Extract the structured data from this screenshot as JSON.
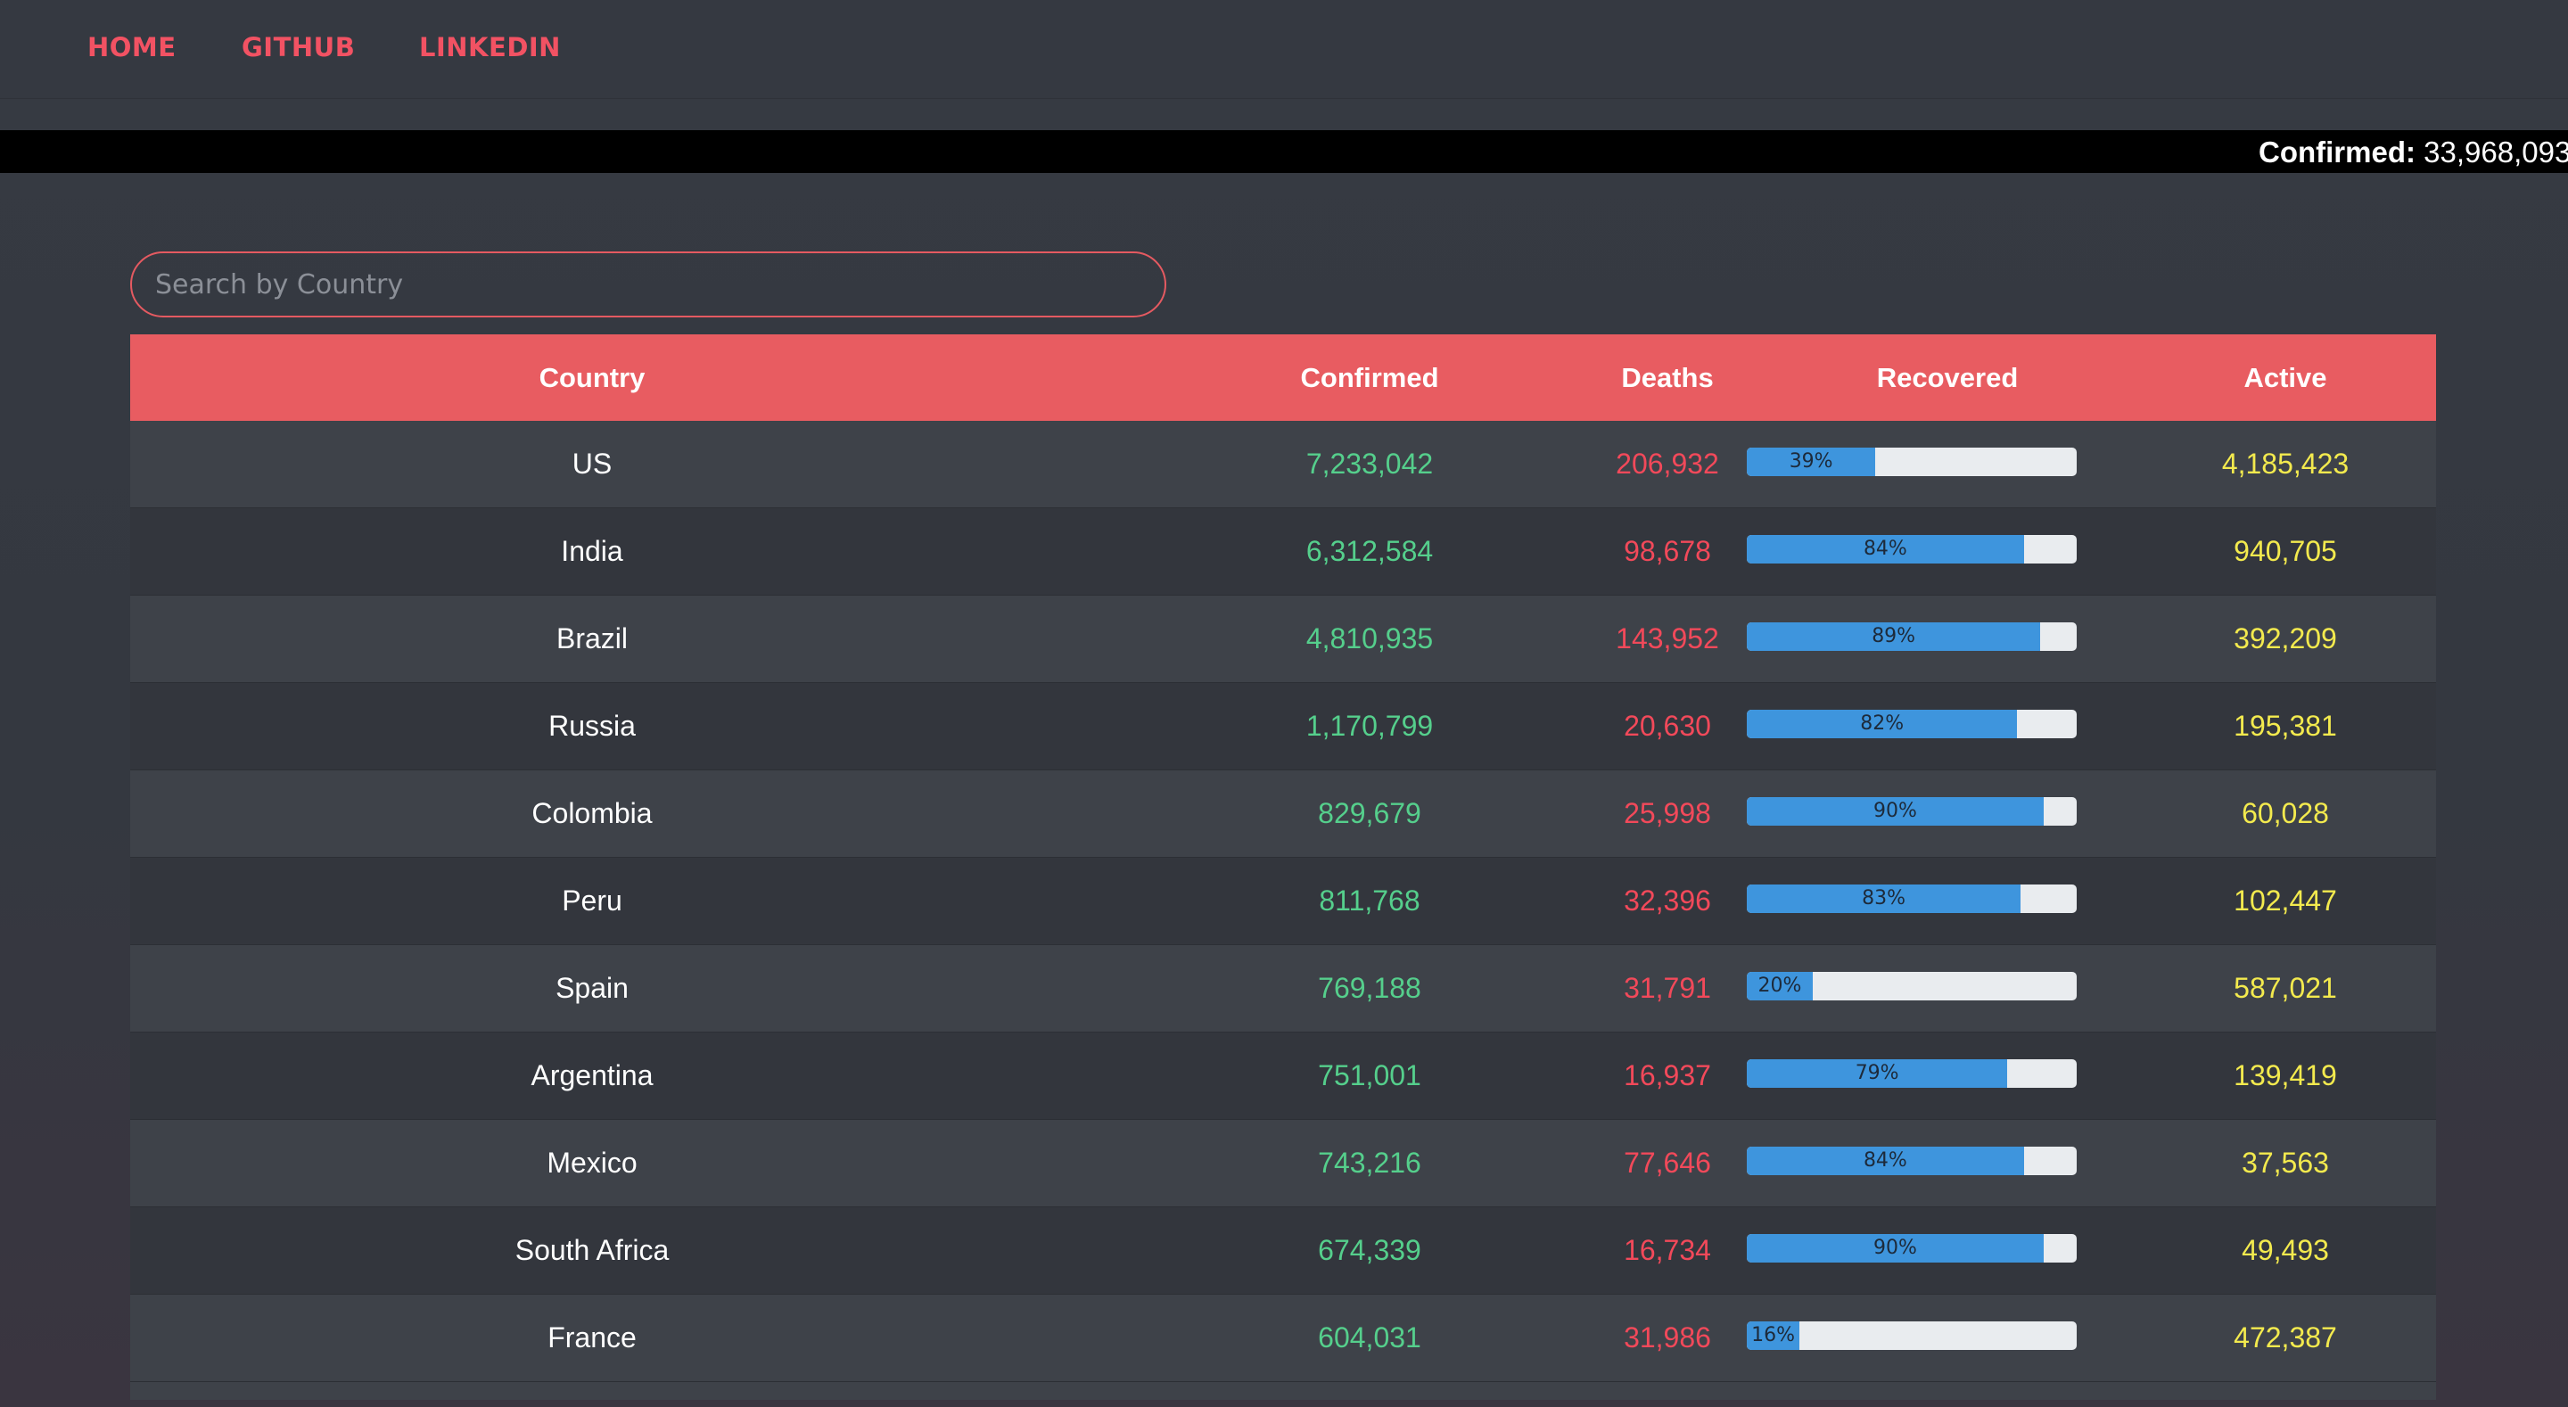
{
  "nav": {
    "home": "HOME",
    "github": "GITHUB",
    "linkedin": "LINKEDIN"
  },
  "ticker": {
    "label": "Confirmed:",
    "value": "33,968,093"
  },
  "search": {
    "placeholder": "Search by Country"
  },
  "table": {
    "headers": {
      "country": "Country",
      "confirmed": "Confirmed",
      "deaths": "Deaths",
      "recovered": "Recovered",
      "active": "Active"
    },
    "rows": [
      {
        "country": "US",
        "confirmed": "7,233,042",
        "deaths": "206,932",
        "recovered_pct": 39,
        "recovered_label": "39%",
        "active": "4,185,423"
      },
      {
        "country": "India",
        "confirmed": "6,312,584",
        "deaths": "98,678",
        "recovered_pct": 84,
        "recovered_label": "84%",
        "active": "940,705"
      },
      {
        "country": "Brazil",
        "confirmed": "4,810,935",
        "deaths": "143,952",
        "recovered_pct": 89,
        "recovered_label": "89%",
        "active": "392,209"
      },
      {
        "country": "Russia",
        "confirmed": "1,170,799",
        "deaths": "20,630",
        "recovered_pct": 82,
        "recovered_label": "82%",
        "active": "195,381"
      },
      {
        "country": "Colombia",
        "confirmed": "829,679",
        "deaths": "25,998",
        "recovered_pct": 90,
        "recovered_label": "90%",
        "active": "60,028"
      },
      {
        "country": "Peru",
        "confirmed": "811,768",
        "deaths": "32,396",
        "recovered_pct": 83,
        "recovered_label": "83%",
        "active": "102,447"
      },
      {
        "country": "Spain",
        "confirmed": "769,188",
        "deaths": "31,791",
        "recovered_pct": 20,
        "recovered_label": "20%",
        "active": "587,021"
      },
      {
        "country": "Argentina",
        "confirmed": "751,001",
        "deaths": "16,937",
        "recovered_pct": 79,
        "recovered_label": "79%",
        "active": "139,419"
      },
      {
        "country": "Mexico",
        "confirmed": "743,216",
        "deaths": "77,646",
        "recovered_pct": 84,
        "recovered_label": "84%",
        "active": "37,563"
      },
      {
        "country": "South Africa",
        "confirmed": "674,339",
        "deaths": "16,734",
        "recovered_pct": 90,
        "recovered_label": "90%",
        "active": "49,493"
      },
      {
        "country": "France",
        "confirmed": "604,031",
        "deaths": "31,986",
        "recovered_pct": 16,
        "recovered_label": "16%",
        "active": "472,387"
      }
    ]
  },
  "colors": {
    "accent": "#e85c61",
    "confirmed": "#55cf8c",
    "deaths": "#f2495a",
    "active": "#f3ea4e",
    "progress": "#3e95dd"
  }
}
